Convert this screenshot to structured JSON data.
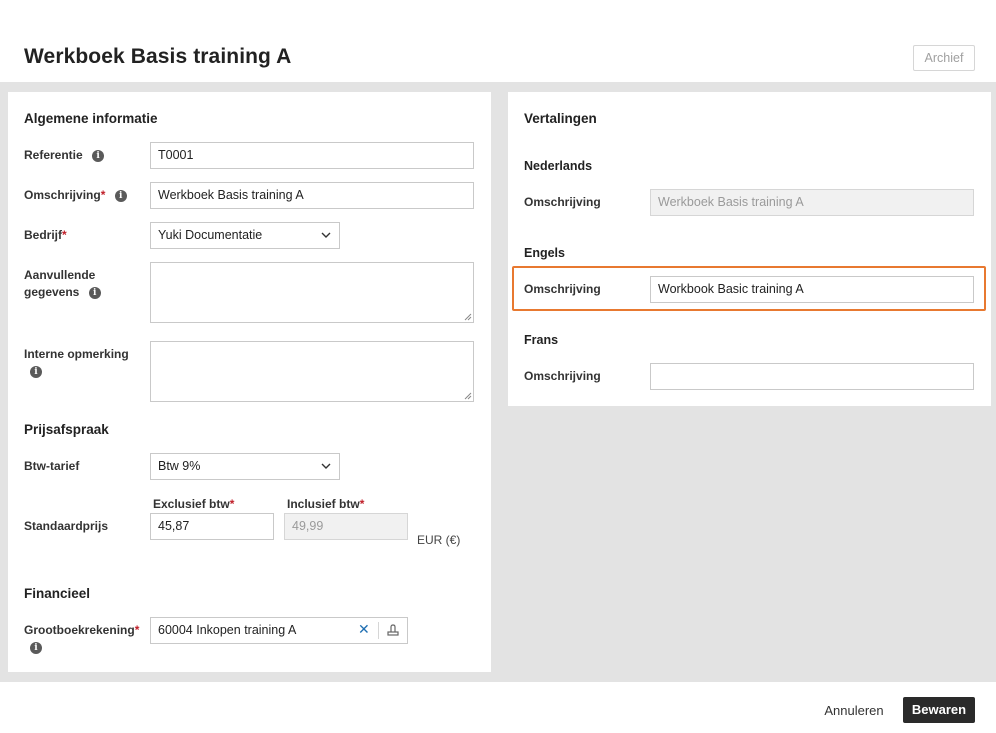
{
  "header": {
    "title": "Werkboek Basis training A",
    "archive_label": "Archief"
  },
  "general": {
    "section_title": "Algemene informatie",
    "reference_label": "Referentie",
    "reference_value": "T0001",
    "description_label": "Omschrijving",
    "description_value": "Werkboek Basis training A",
    "company_label": "Bedrijf",
    "company_value": "Yuki Documentatie",
    "additional_label_line1": "Aanvullende",
    "additional_label_line2": "gegevens",
    "additional_value": "",
    "internal_label": "Interne opmerking",
    "internal_value": "",
    "required_mark": "*"
  },
  "pricing": {
    "section_title": "Prijsafspraak",
    "vat_label": "Btw-tarief",
    "vat_value": "Btw 9%",
    "excl_header": "Exclusief btw",
    "incl_header": "Inclusief btw",
    "standard_price_label": "Standaardprijs",
    "excl_value": "45,87",
    "incl_value": "49,99",
    "currency": "EUR (€)"
  },
  "financial": {
    "section_title": "Financieel",
    "ledger_label": "Grootboekrekening",
    "ledger_value": "60004 Inkopen training A"
  },
  "translations": {
    "section_title": "Vertalingen",
    "dutch_title": "Nederlands",
    "dutch_label": "Omschrijving",
    "dutch_value": "Werkboek Basis training A",
    "english_title": "Engels",
    "english_label": "Omschrijving",
    "english_value": "Workbook Basic training A",
    "french_title": "Frans",
    "french_label": "Omschrijving",
    "french_value": ""
  },
  "footer": {
    "cancel_label": "Annuleren",
    "save_label": "Bewaren"
  },
  "colors": {
    "highlight": "#e87930",
    "required": "#c0202a",
    "save_button": "#2a2a2a",
    "background": "#e3e3e3"
  },
  "icons": {
    "info": "info-circle-icon",
    "chevron": "chevron-down-icon",
    "clear": "close-icon",
    "lookup": "lookup-icon"
  }
}
